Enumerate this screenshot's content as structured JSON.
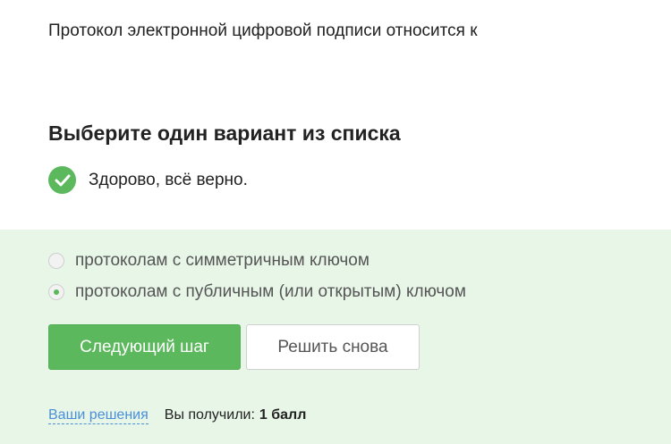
{
  "question": {
    "text": "Протокол электронной цифровой подписи относится к"
  },
  "task": {
    "title": "Выберите один вариант из списка"
  },
  "feedback": {
    "icon": "checkmark-icon",
    "text": "Здорово, всё верно.",
    "color": "#5cb85c"
  },
  "options": [
    {
      "label": "протоколам с симметричным ключом",
      "selected": false
    },
    {
      "label": "протоколам с публичным (или открытым) ключом",
      "selected": true
    }
  ],
  "buttons": {
    "next_label": "Следующий шаг",
    "retry_label": "Решить снова"
  },
  "footer": {
    "solutions_link": "Ваши решения",
    "score_label": "Вы получили:",
    "score_value": "1 балл"
  },
  "colors": {
    "accent": "#5cb85c",
    "answer_background": "#e8f6e8",
    "link": "#4a8fd9"
  }
}
